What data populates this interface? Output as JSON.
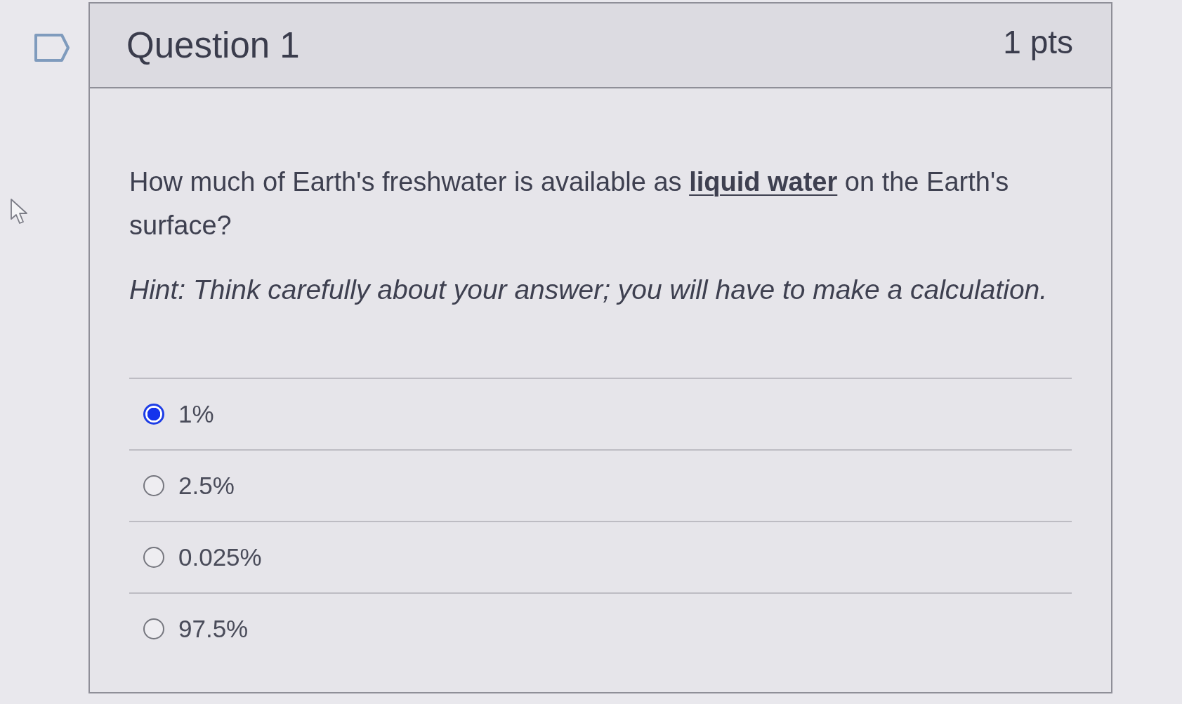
{
  "gutter": {
    "flagged": false
  },
  "question": {
    "title": "Question 1",
    "points": "1 pts"
  },
  "prompt": "How much of Earth's freshwater is available as **liquid water** on the Earth's surface?",
  "hint": "Hint: Think carefully about your answer; you will have to make a calculation.",
  "answers": [
    {
      "label": "1%",
      "selected": true
    },
    {
      "label": "2.5%",
      "selected": false
    },
    {
      "label": "0.025%",
      "selected": false
    },
    {
      "label": "97.5%",
      "selected": false
    }
  ]
}
